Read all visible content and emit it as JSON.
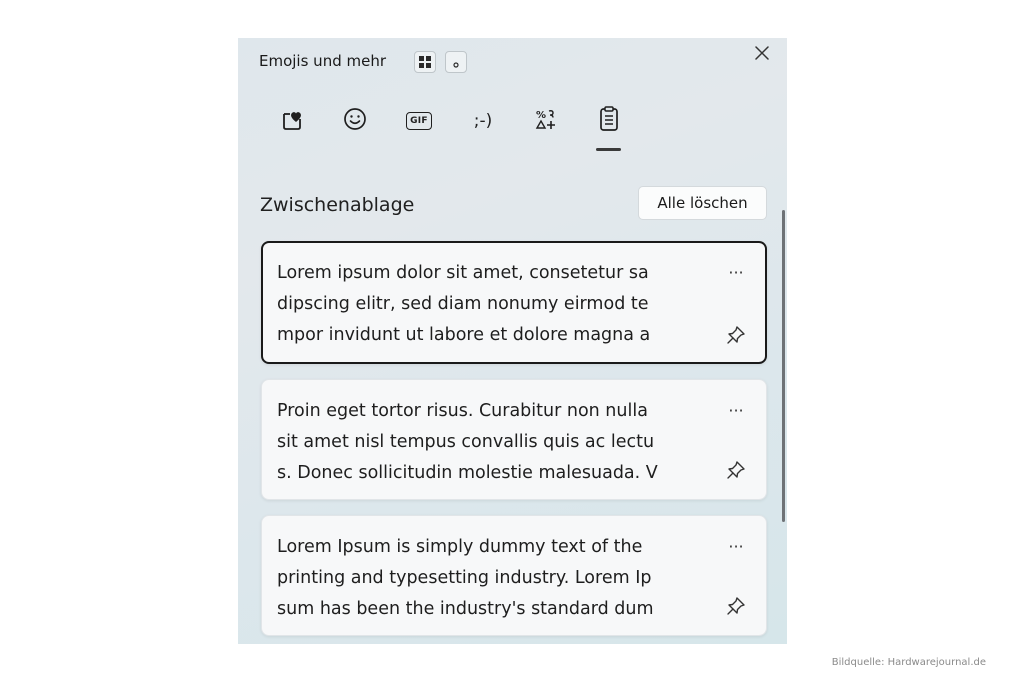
{
  "header": {
    "title": "Emojis und mehr"
  },
  "tabs": [
    {
      "name": "tab-recent",
      "icon": "heart-recent-icon"
    },
    {
      "name": "tab-emoji",
      "icon": "smiley-icon"
    },
    {
      "name": "tab-gif",
      "icon": "gif-icon",
      "label": "GIF"
    },
    {
      "name": "tab-kaomoji",
      "icon": "kaomoji-icon",
      "label": ";-)"
    },
    {
      "name": "tab-symbols",
      "icon": "symbols-icon"
    },
    {
      "name": "tab-clipboard",
      "icon": "clipboard-icon",
      "selected": true
    }
  ],
  "clipboard": {
    "section_title": "Zwischenablage",
    "clear_all_label": "Alle löschen",
    "items": [
      {
        "text": "Lorem ipsum dolor sit amet, consetetur sa\ndipscing elitr, sed diam nonumy eirmod te\nmpor invidunt ut labore et dolore magna a",
        "selected": true
      },
      {
        "text": "Proin eget tortor risus. Curabitur non nulla\nsit amet nisl tempus convallis quis ac lectu\ns. Donec sollicitudin molestie malesuada. V"
      },
      {
        "text": "Lorem Ipsum is simply dummy text of the\nprinting and typesetting industry. Lorem Ip\nsum has been the industry's standard dum"
      }
    ],
    "more_label": "···"
  },
  "credit": "Bildquelle: Hardwarejournal.de"
}
